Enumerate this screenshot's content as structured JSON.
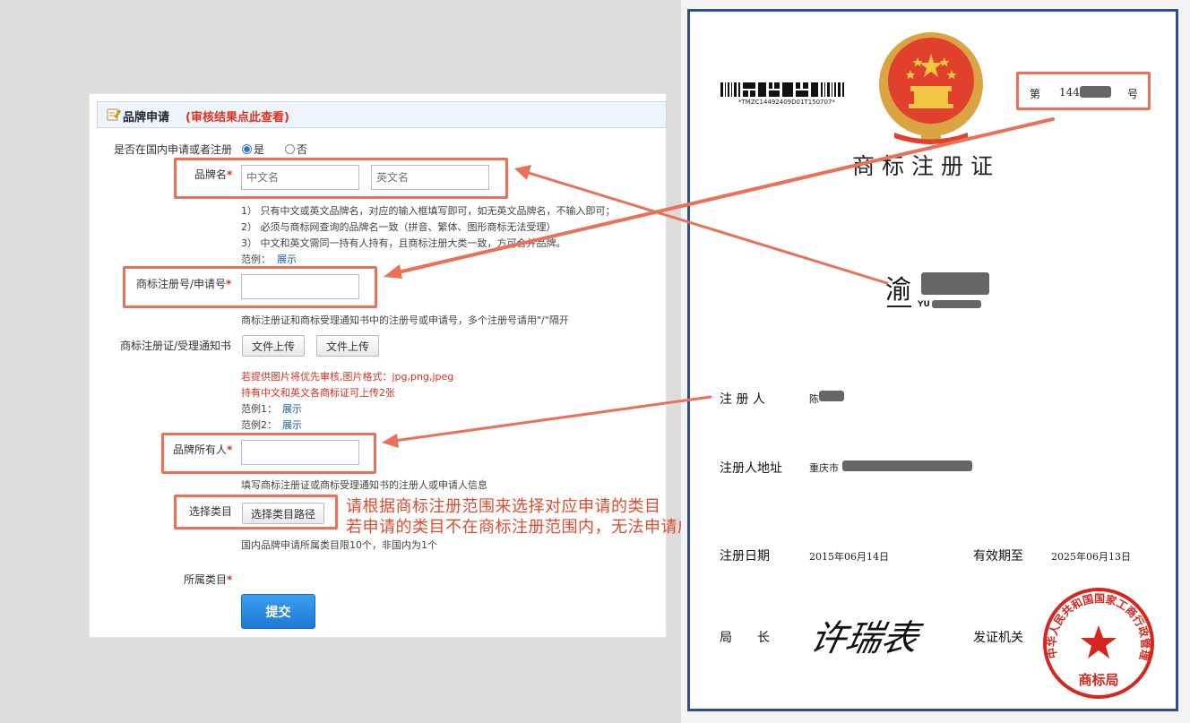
{
  "panel": {
    "title": "品牌申请",
    "review_link": "(审核结果点此查看)"
  },
  "form": {
    "domestic": {
      "label": "是否在国内申请或者注册",
      "yes": "是",
      "no": "否"
    },
    "brand_name": {
      "label": "品牌名",
      "required": "*",
      "cn_placeholder": "中文名",
      "en_placeholder": "英文名",
      "hints": [
        "1） 只有中文或英文品牌名，对应的输入框填写即可，如无英文品牌名，不输入即可；",
        "2） 必须与商标网查询的品牌名一致（拼音、繁体、图形商标无法受理）",
        "3） 中文和英文需同一持有人持有，且商标注册大类一致，方可合并品牌。"
      ],
      "example_label": "范例：",
      "example_link": "展示"
    },
    "reg_no": {
      "label": "商标注册号/申请号",
      "required": "*",
      "hint": "商标注册证和商标受理通知书中的注册号或申请号，多个注册号请用\"/\"隔开"
    },
    "upload": {
      "label": "商标注册证/受理通知书",
      "button1": "文件上传",
      "button2": "文件上传",
      "note1": "若提供图片将优先审核,图片格式：jpg,png,jpeg",
      "note2": "持有中文和英文各商标证可上传2张",
      "example1_label": "范例1：",
      "example1_link": "展示",
      "example2_label": "范例2：",
      "example2_link": "展示"
    },
    "owner": {
      "label": "品牌所有人",
      "required": "*",
      "hint": "填写商标注册证或商标受理通知书的注册人或申请人信息"
    },
    "category": {
      "label": "选择类目",
      "button": "选择类目路径",
      "hint": "国内品牌申请所属类目限10个，非国内为1个"
    },
    "belong": {
      "label": "所属类目",
      "required": "*"
    },
    "submit": "提交"
  },
  "annotation": {
    "line1": "请根据商标注册范围来选择对应申请的类目",
    "line2": "若申请的类目不在商标注册范围内，无法申请成功哦！"
  },
  "certificate": {
    "barcode_text": "*TMZC14492409D01T150707*",
    "number_prefix": "第",
    "number_value": "144",
    "number_suffix": "号",
    "title": "商标注册证",
    "mark_char": "渝",
    "mark_latin": "YU",
    "registrant_label": "注 册 人",
    "registrant_value": "陈",
    "address_label": "注册人地址",
    "address_value": "重庆市",
    "reg_date_label": "注册日期",
    "reg_date_value": "2015年06月14日",
    "valid_label": "有效期至",
    "valid_value": "2025年06月13日",
    "director_label": "局　　长",
    "signature": "许瑞表",
    "issuer_label": "发证机关",
    "seal_ring": "中华人民共和国国家工商行政管理总局",
    "seal_center": "商标局"
  },
  "colors": {
    "highlight": "#ea7058",
    "required": "#e0301e",
    "link": "#1a5fb4",
    "submit": "#1e7ad6",
    "cert_border": "#2f4f8f",
    "seal": "#d8261e"
  }
}
